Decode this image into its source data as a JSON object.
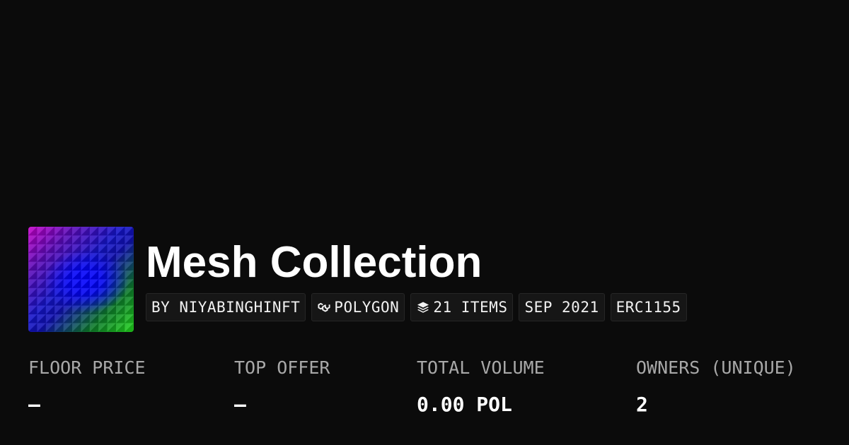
{
  "collection": {
    "name": "Mesh Collection",
    "thumbnail_icon": "mesh-artwork-thumbnail"
  },
  "tags": {
    "creator": "BY NIYABINGHINFT",
    "chain": "POLYGON",
    "chain_icon": "polygon-chain-icon",
    "items": "21 ITEMS",
    "items_icon": "layers-icon",
    "date": "SEP 2021",
    "standard": "ERC1155"
  },
  "stats": {
    "floor_price": {
      "label": "FLOOR PRICE",
      "value": "–"
    },
    "top_offer": {
      "label": "TOP OFFER",
      "value": "–"
    },
    "total_volume": {
      "label": "TOTAL VOLUME",
      "value": "0.00 POL"
    },
    "owners": {
      "label": "OWNERS (UNIQUE)",
      "value": "2"
    }
  },
  "colors": {
    "background": "#0b0b0b",
    "text": "#ffffff",
    "muted_text": "#a8a8a8",
    "tag_background": "#161616"
  }
}
